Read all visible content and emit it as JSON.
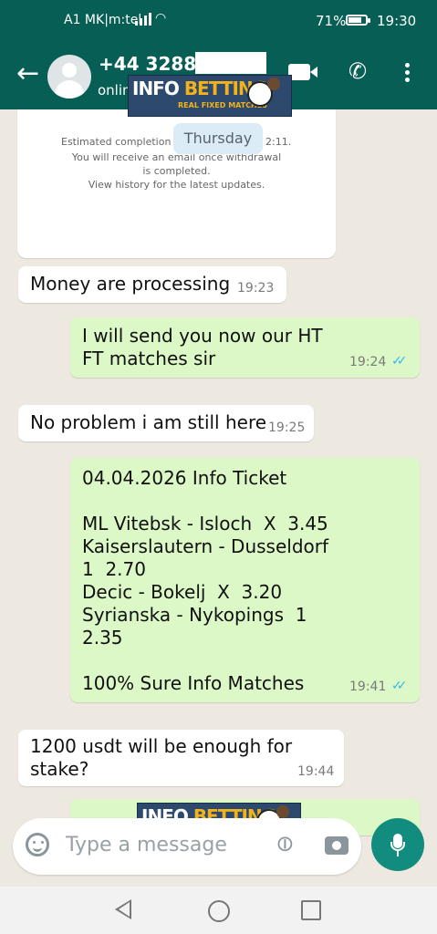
{
  "status_bar": {
    "carrier": "A1 MK|m:tel",
    "battery": "71%",
    "battery_level": 0.71,
    "time": "19:30"
  },
  "header": {
    "contact": "+44 3288 1",
    "presence": "onlin"
  },
  "watermark": {
    "brand_word1": "INFO",
    "brand_word2": "BETTING",
    "tagline": "REAL FIXED MATCHES"
  },
  "receipt_card": {
    "line1_start": "Estimated completion tin",
    "line1_end": "2:11.",
    "line2": "You will receive an email once withdrawal",
    "line3": "is completed.",
    "line4": "View history for the latest updates."
  },
  "day_chip": "Thursday",
  "messages": [
    {
      "direction": "in",
      "text": "Money are processing",
      "time": "19:23"
    },
    {
      "direction": "out",
      "text": "I will send you now our HT\nFT matches sir",
      "time": "19:24",
      "read": true
    },
    {
      "direction": "in",
      "text": "No problem i am still here",
      "time": "19:25"
    },
    {
      "direction": "out",
      "text": "04.04.2026 Info Ticket\n\nML Vitebsk - Isloch  X  3.45\nKaiserslautern - Dusseldorf\n1  2.70\nDecic - Bokelj  X  3.20\nSyrianska - Nykopings  1\n2.35\n\n100% Sure Info Matches",
      "time": "19:41",
      "read": true
    },
    {
      "direction": "in",
      "text": "1200 usdt will be enough for\nstake?",
      "time": "19:44"
    }
  ],
  "input": {
    "placeholder": "Type a message"
  },
  "colors": {
    "header": "#075e54",
    "outgoing_bubble": "#dcf8c6",
    "incoming_bubble": "#ffffff",
    "chat_background": "#eee9e0",
    "read_ticks": "#34b7f1",
    "mic_button": "#128c7e"
  },
  "icons": [
    "back-arrow-icon",
    "avatar-icon",
    "video-call-icon",
    "phone-icon",
    "more-menu-icon",
    "emoji-icon",
    "attach-icon",
    "camera-icon",
    "mic-icon",
    "nav-back-icon",
    "nav-home-icon",
    "nav-recents-icon"
  ]
}
